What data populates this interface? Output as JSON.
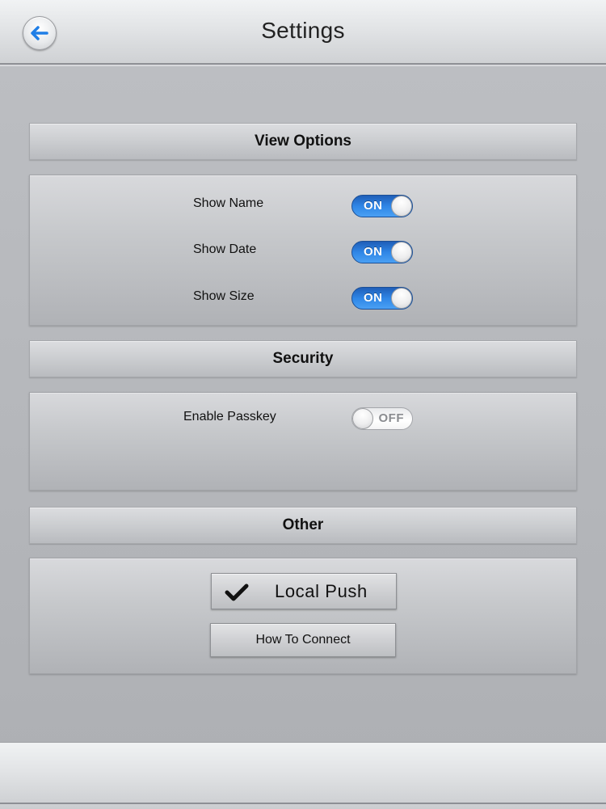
{
  "header": {
    "title": "Settings",
    "back_icon": "arrow-left-icon"
  },
  "colors": {
    "toggle_on": "#2f86e6",
    "back_arrow": "#1f7ee6"
  },
  "sections": {
    "view_options": {
      "title": "View Options",
      "rows": [
        {
          "label": "Show Name",
          "state": "ON"
        },
        {
          "label": "Show Date",
          "state": "ON"
        },
        {
          "label": "Show Size",
          "state": "ON"
        }
      ]
    },
    "security": {
      "title": "Security",
      "rows": [
        {
          "label": "Enable Passkey",
          "state": "OFF"
        }
      ]
    },
    "other": {
      "title": "Other",
      "local_push_label": "Local Push",
      "local_push_icon": "checkmark-icon",
      "how_to_connect_label": "How To Connect"
    }
  }
}
